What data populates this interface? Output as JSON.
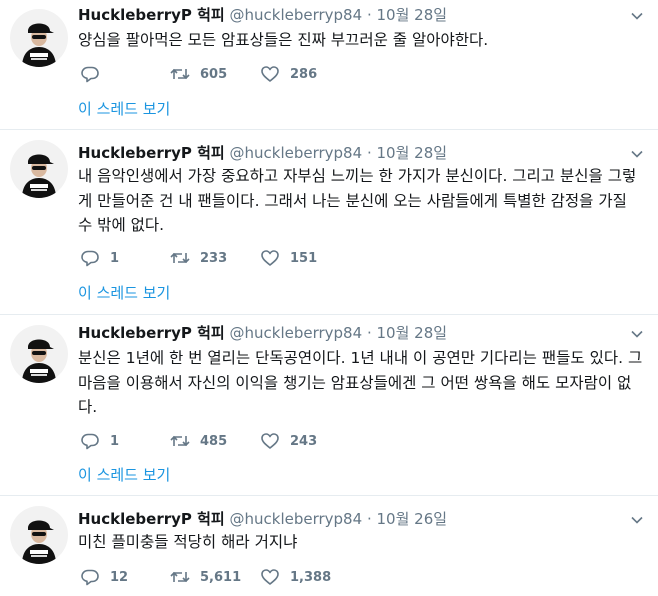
{
  "colors": {
    "link": "#1b95e0",
    "muted": "#657786",
    "text": "#14171a",
    "divider": "#e6ecf0"
  },
  "icons": {
    "reply": "reply-icon",
    "retweet": "retweet-icon",
    "like": "heart-icon",
    "more": "chevron-down-icon"
  },
  "tweets": [
    {
      "name": "HuckleberryP 헉피",
      "handle": "@huckleberryp84",
      "separator": "·",
      "date": "10월 28일",
      "text": "양심을 팔아먹은 모든 암표상들은 진짜 부끄러운 줄 알아야한다.",
      "replies": "",
      "retweets": "605",
      "likes": "286",
      "thread_link": "이 스레드 보기"
    },
    {
      "name": "HuckleberryP 헉피",
      "handle": "@huckleberryp84",
      "separator": "·",
      "date": "10월 28일",
      "text": "내 음악인생에서 가장 중요하고 자부심 느끼는 한 가지가 분신이다. 그리고 분신을 그렇게 만들어준 건 내 팬들이다. 그래서 나는 분신에 오는 사람들에게 특별한 감정을 가질 수 밖에 없다.",
      "replies": "1",
      "retweets": "233",
      "likes": "151",
      "thread_link": "이 스레드 보기"
    },
    {
      "name": "HuckleberryP 헉피",
      "handle": "@huckleberryp84",
      "separator": "·",
      "date": "10월 28일",
      "text": "분신은 1년에 한 번 열리는 단독공연이다. 1년 내내 이 공연만 기다리는 팬들도 있다. 그 마음을 이용해서 자신의 이익을 챙기는 암표상들에겐 그 어떤 쌍욕을 해도 모자람이 없다.",
      "replies": "1",
      "retweets": "485",
      "likes": "243",
      "thread_link": "이 스레드 보기"
    },
    {
      "name": "HuckleberryP 헉피",
      "handle": "@huckleberryp84",
      "separator": "·",
      "date": "10월 26일",
      "text": "미친 플미충들 적당히 해라 거지냐",
      "replies": "12",
      "retweets": "5,611",
      "likes": "1,388",
      "thread_link": ""
    }
  ]
}
